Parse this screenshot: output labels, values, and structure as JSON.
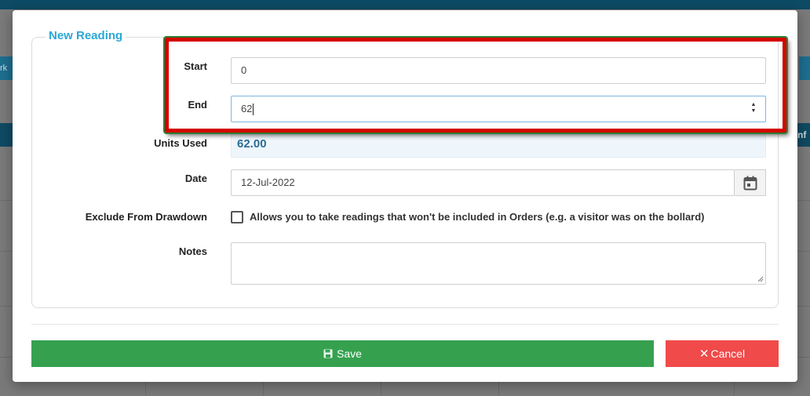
{
  "background": {
    "left_button_text": "rk",
    "right_header_text": "nf"
  },
  "form": {
    "legend": "New Reading",
    "start": {
      "label": "Start",
      "value": "0"
    },
    "end": {
      "label": "End",
      "value": "62"
    },
    "units_used": {
      "label": "Units Used",
      "value": "62.00"
    },
    "date": {
      "label": "Date",
      "value": "12-Jul-2022"
    },
    "exclude": {
      "label": "Exclude From Drawdown",
      "checked": false,
      "description": "Allows you to take readings that won't be included in Orders (e.g. a visitor was on the bollard)"
    },
    "notes": {
      "label": "Notes",
      "value": ""
    }
  },
  "actions": {
    "save_label": "Save",
    "cancel_label": "Cancel"
  },
  "colors": {
    "legend": "#29a8d6",
    "save": "#35a14f",
    "cancel": "#f04a4a",
    "highlight": "#d40000"
  }
}
